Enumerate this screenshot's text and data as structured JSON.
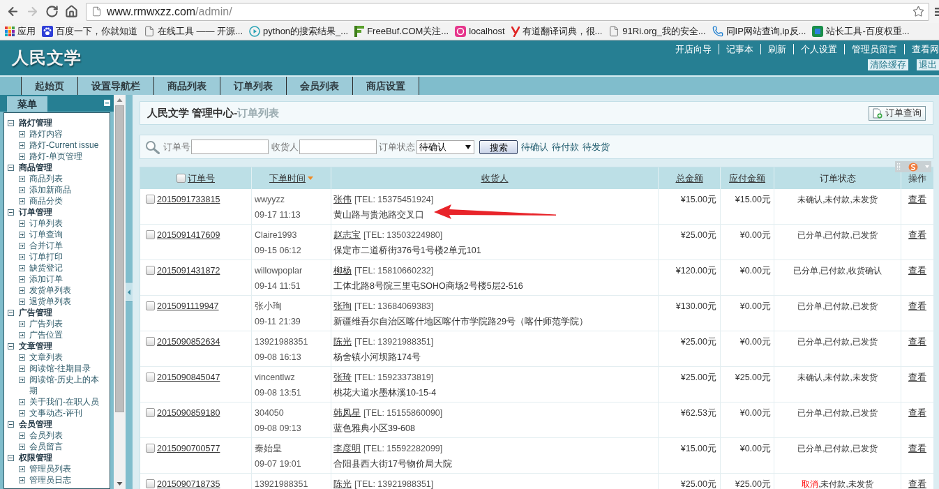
{
  "browser": {
    "nav_buttons": [
      {
        "disabled": false
      },
      {
        "disabled": true
      },
      {
        "disabled": false
      },
      {
        "disabled": false
      }
    ],
    "address": {
      "host": "www.rmwxzz.com",
      "path": "/admin/"
    },
    "bookmarks": [
      "应用",
      "百度一下，你就知道",
      "在线工具 —— 开源...",
      "python的搜索结果_...",
      "FreeBuf.COM关注...",
      "localhost",
      "有道翻译词典，很...",
      "91Ri.org_我的安全...",
      "同IP网站查询,ip反...",
      "站长工具-百度权重..."
    ]
  },
  "header": {
    "logo": "人民文学",
    "links": [
      "开店向导",
      "记事本",
      "刷新",
      "个人设置",
      "管理员留言",
      "查看网"
    ],
    "buttons": [
      "清除缓存",
      "退出"
    ]
  },
  "nav_tabs": [
    {
      "label": "起始页",
      "selected": false
    },
    {
      "label": "设置导航栏",
      "selected": false
    },
    {
      "label": "商品列表",
      "selected": false
    },
    {
      "label": "订单列表",
      "selected": false
    },
    {
      "label": "会员列表",
      "selected": false
    },
    {
      "label": "商店设置",
      "selected": false
    }
  ],
  "sidebar": {
    "tab": "菜单",
    "groups": [
      {
        "label": "路灯管理",
        "expanded": true,
        "children": [
          "路灯内容",
          "路灯-Current issue",
          "路灯-单页管理"
        ]
      },
      {
        "label": "商品管理",
        "expanded": true,
        "children": [
          "商品列表",
          "添加新商品",
          "商品分类"
        ]
      },
      {
        "label": "订单管理",
        "expanded": true,
        "children": [
          "订单列表",
          "订单查询",
          "合并订单",
          "订单打印",
          "缺货登记",
          "添加订单",
          "发货单列表",
          "退货单列表"
        ]
      },
      {
        "label": "广告管理",
        "expanded": true,
        "children": [
          "广告列表",
          "广告位置"
        ]
      },
      {
        "label": "文章管理",
        "expanded": true,
        "children": [
          "文章列表",
          "阅读馆-往期目录",
          "阅读馆-历史上的本期",
          "关于我们-在职人员",
          "文事动态-评刊"
        ]
      },
      {
        "label": "会员管理",
        "expanded": true,
        "children": [
          "会员列表",
          "会员留言"
        ]
      },
      {
        "label": "权限管理",
        "expanded": true,
        "children": [
          "管理员列表",
          "管理员日志"
        ]
      }
    ]
  },
  "page_title": {
    "site": "人民文学 管理中心-",
    "section": "订单列表",
    "button": "订单查询"
  },
  "search": {
    "fields": [
      {
        "label": "订单号"
      },
      {
        "label": "收货人"
      }
    ],
    "status": {
      "label": "订单状态",
      "value": "待确认"
    },
    "button": "搜索",
    "quick_links": [
      "待确认",
      "待付款",
      "待发货"
    ]
  },
  "table": {
    "select_all": {
      "checked": false
    },
    "columns": [
      {
        "label": "订单号",
        "link": true,
        "sorted": false
      },
      {
        "label": "下单时间",
        "link": true,
        "sorted": true
      },
      {
        "label": "收货人",
        "link": true,
        "sorted": false
      },
      {
        "label": "总金额",
        "link": true,
        "sorted": false
      },
      {
        "label": "应付金额",
        "link": true,
        "sorted": false
      },
      {
        "label": "订单状态",
        "link": false,
        "sorted": false
      },
      {
        "label": "操作",
        "link": false,
        "sorted": false
      }
    ],
    "rows": [
      {
        "checked": false,
        "order_no": "2015091733815",
        "user": "wwyyzz",
        "time": "09-17 11:13",
        "consignee": "张伟",
        "tel": "[TEL: 15375451924]",
        "address": "黄山路与贵池路交叉口",
        "total": "¥15.00元",
        "payable": "¥15.00元",
        "status": [
          {
            "text": "未确认,未付款,未发货",
            "alert": false
          }
        ],
        "action": "查看"
      },
      {
        "checked": false,
        "order_no": "2015091417609",
        "user": "Claire1993",
        "time": "09-15 06:12",
        "consignee": "赵志宝",
        "tel": "[TEL: 13503224980]",
        "address": "保定市二道桥街376号1号楼2单元101",
        "total": "¥25.00元",
        "payable": "¥0.00元",
        "status": [
          {
            "text": "已分单,已付款,已发货",
            "alert": false
          }
        ],
        "action": "查看"
      },
      {
        "checked": false,
        "order_no": "2015091431872",
        "user": "willowpoplar",
        "time": "09-14 11:51",
        "consignee": "柳杨",
        "tel": "[TEL: 15810660232]",
        "address": "工体北路8号院三里屯SOHO商场2号楼5层2-516",
        "total": "¥120.00元",
        "payable": "¥0.00元",
        "status": [
          {
            "text": "已分单,已付款,收货确认",
            "alert": false
          }
        ],
        "action": "查看"
      },
      {
        "checked": false,
        "order_no": "2015091119947",
        "user": "张小珣",
        "time": "09-11 21:39",
        "consignee": "张珣",
        "tel": "[TEL: 13684069383]",
        "address": "新疆维吾尔自治区喀什地区喀什市学院路29号（喀什师范学院）",
        "total": "¥130.00元",
        "payable": "¥0.00元",
        "status": [
          {
            "text": "已分单,已付款,已发货",
            "alert": false
          }
        ],
        "action": "查看"
      },
      {
        "checked": false,
        "order_no": "2015090852634",
        "user": "13921988351",
        "time": "09-08 16:13",
        "consignee": "陈光",
        "tel": "[TEL: 13921988351]",
        "address": "杨舍镇小河坝路174号",
        "total": "¥25.00元",
        "payable": "¥0.00元",
        "status": [
          {
            "text": "已分单,已付款,已发货",
            "alert": false
          }
        ],
        "action": "查看"
      },
      {
        "checked": false,
        "order_no": "2015090845047",
        "user": "vincentlwz",
        "time": "09-08 13:51",
        "consignee": "张琦",
        "tel": "[TEL: 15923373819]",
        "address": "桃花大道水墨林溪10-15-4",
        "total": "¥25.00元",
        "payable": "¥25.00元",
        "status": [
          {
            "text": "未确认,未付款,未发货",
            "alert": false
          }
        ],
        "action": "查看"
      },
      {
        "checked": false,
        "order_no": "2015090859180",
        "user": "304050",
        "time": "09-08 09:13",
        "consignee": "韩凤星",
        "tel": "[TEL: 15155860090]",
        "address": "蓝色雅典小区39-608",
        "total": "¥62.53元",
        "payable": "¥0.00元",
        "status": [
          {
            "text": "已分单,已付款,已发货",
            "alert": false
          }
        ],
        "action": "查看"
      },
      {
        "checked": false,
        "order_no": "2015090700577",
        "user": "秦始皇",
        "time": "09-07 19:01",
        "consignee": "李彦明",
        "tel": "[TEL: 15592282099]",
        "address": "合阳县西大街17号物价局大院",
        "total": "¥15.00元",
        "payable": "¥0.00元",
        "status": [
          {
            "text": "已分单,已付款,已发货",
            "alert": false
          }
        ],
        "action": "查看"
      },
      {
        "checked": false,
        "order_no": "2015090718735",
        "user": "13921988351",
        "consignee": "陈光",
        "tel": "[TEL: 13921988351]",
        "total": "¥25.00元",
        "payable": "¥25.00元",
        "status": [
          {
            "text": "取消",
            "alert": true
          },
          {
            "text": ",未付款,未发货",
            "alert": false
          }
        ],
        "action": "查看"
      }
    ]
  }
}
